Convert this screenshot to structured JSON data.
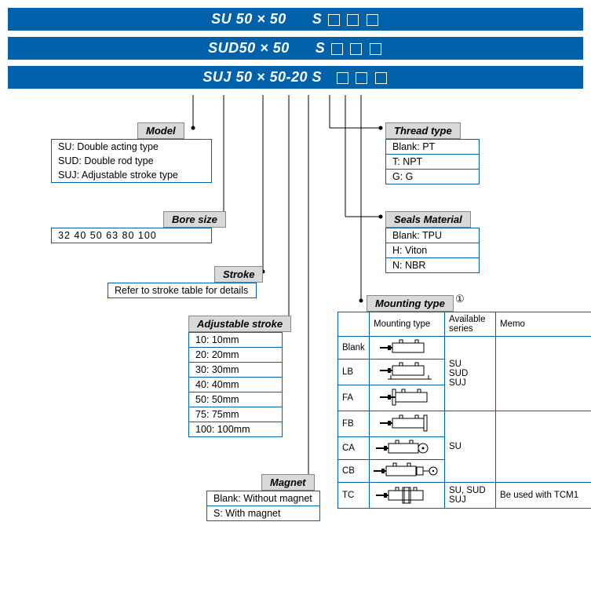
{
  "bars": {
    "b1_pre": "SU   50 × 50",
    "b1_s": "S",
    "b2_pre": "SUD50 × 50",
    "b2_s": "S",
    "b3_pre": "SUJ 50 × 50-20 S"
  },
  "labels": {
    "model": "Model",
    "bore": "Bore size",
    "stroke": "Stroke",
    "adjstroke": "Adjustable stroke",
    "magnet": "Magnet",
    "thread": "Thread type",
    "seals": "Seals Material",
    "mounting": "Mounting type"
  },
  "model": {
    "r1": "SU: Double acting type",
    "r2": "SUD: Double rod type",
    "r3": "SUJ: Adjustable stroke type"
  },
  "bore": {
    "vals": "32  40  50  63  80  100"
  },
  "stroke": {
    "text": "Refer to stroke table for details"
  },
  "adjstroke": {
    "r1": "10: 10mm",
    "r2": "20: 20mm",
    "r3": "30: 30mm",
    "r4": "40: 40mm",
    "r5": "50: 50mm",
    "r6": "75: 75mm",
    "r7": "100: 100mm"
  },
  "magnet": {
    "r1": "Blank: Without magnet",
    "r2": "S: With magnet"
  },
  "thread": {
    "r1": "Blank: PT",
    "r2": "T: NPT",
    "r3": "G: G"
  },
  "seals": {
    "r1": "Blank: TPU",
    "r2": "H: Viton",
    "r3": "N: NBR"
  },
  "mounting": {
    "note": "①",
    "h1": "Mounting type",
    "h2": "Available series",
    "h3": "Memo",
    "rows": {
      "blank": "Blank",
      "lb": "LB",
      "fa": "FA",
      "fb": "FB",
      "ca": "CA",
      "cb": "CB",
      "tc": "TC"
    },
    "series1": "SU\nSUD\nSUJ",
    "series2": "SU",
    "series3": "SU, SUD\nSUJ",
    "memo3": "Be used with TCM1"
  }
}
